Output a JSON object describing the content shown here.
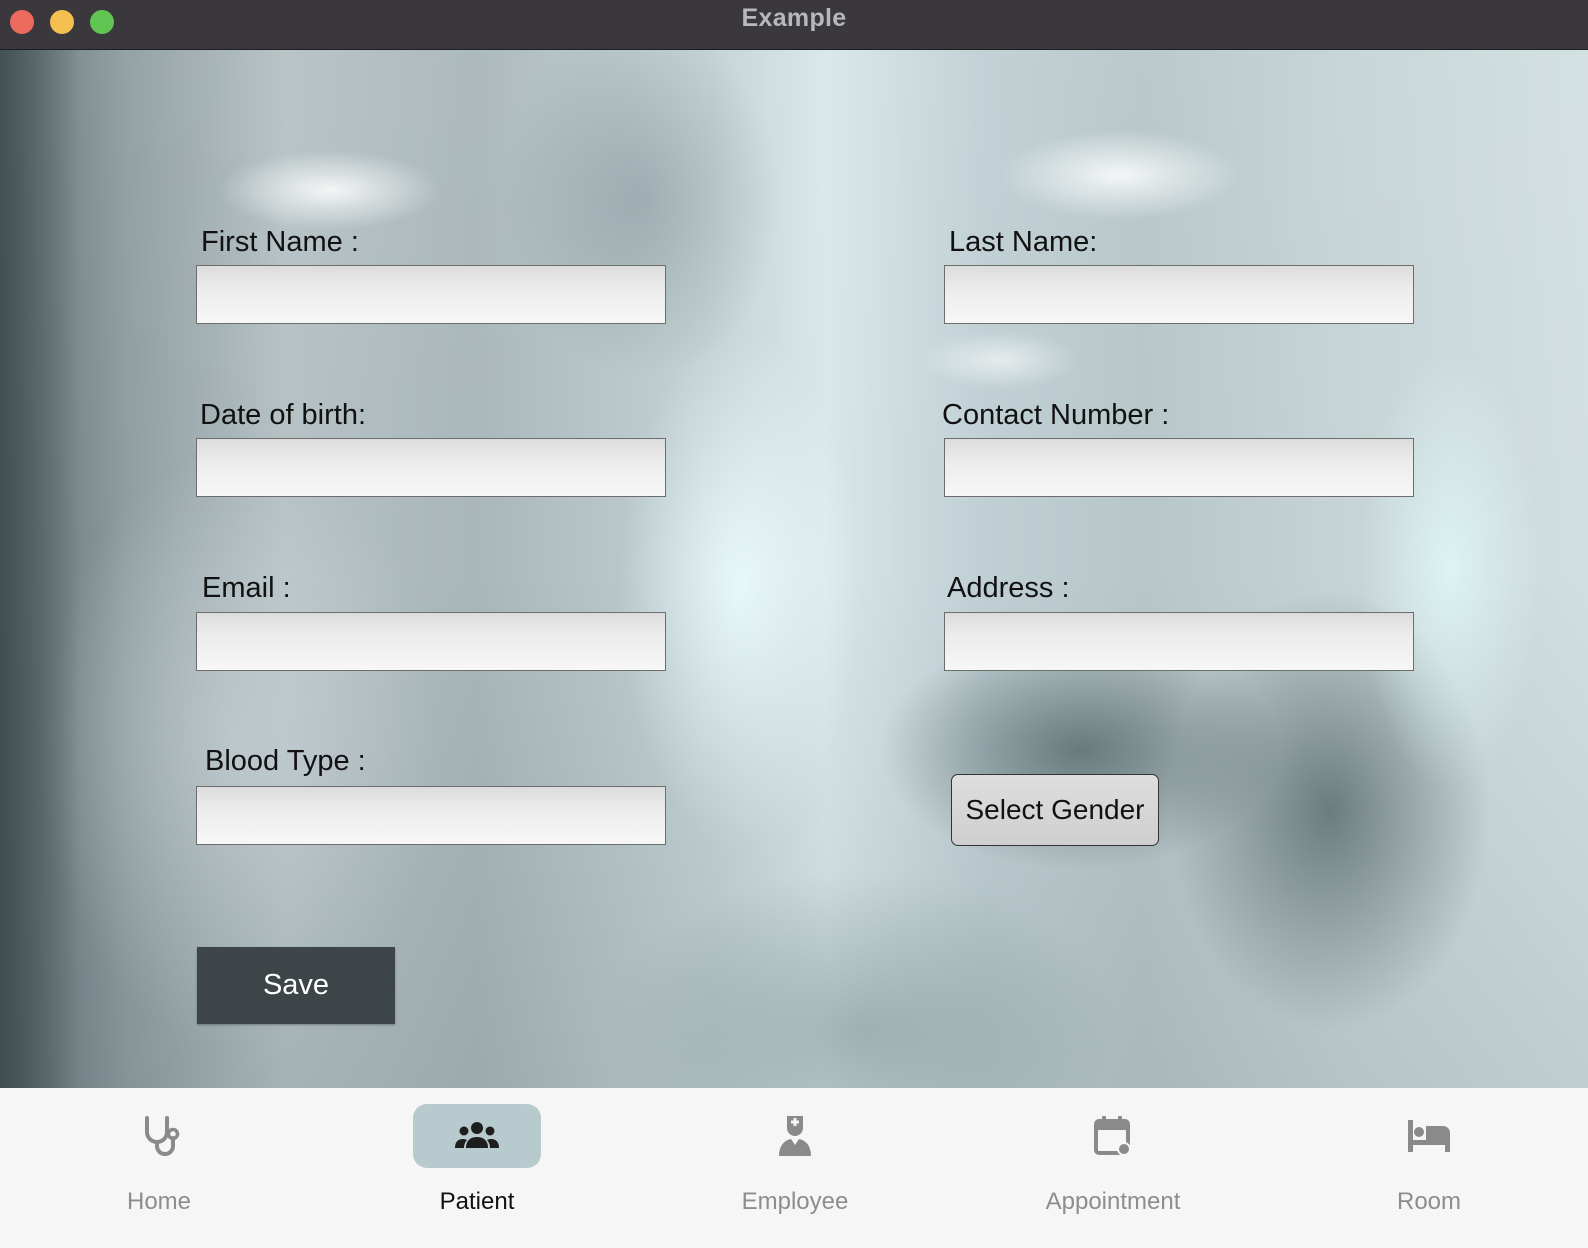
{
  "window": {
    "title": "Example"
  },
  "form": {
    "first_name": {
      "label": "First Name :",
      "value": ""
    },
    "last_name": {
      "label": "Last Name:",
      "value": ""
    },
    "date_of_birth": {
      "label": "Date of birth:",
      "value": ""
    },
    "contact_number": {
      "label": "Contact Number :",
      "value": ""
    },
    "email": {
      "label": "Email :",
      "value": ""
    },
    "address": {
      "label": "Address :",
      "value": ""
    },
    "blood_type": {
      "label": "Blood Type :",
      "value": ""
    },
    "gender_button": "Select Gender",
    "save_button": "Save"
  },
  "bottom_nav": {
    "items": [
      {
        "label": "Home",
        "icon": "stethoscope-icon",
        "active": false
      },
      {
        "label": "Patient",
        "icon": "people-group-icon",
        "active": true
      },
      {
        "label": "Employee",
        "icon": "nurse-icon",
        "active": false
      },
      {
        "label": "Appointment",
        "icon": "calendar-event-icon",
        "active": false
      },
      {
        "label": "Room",
        "icon": "bed-icon",
        "active": false
      }
    ]
  },
  "colors": {
    "title_bar": "#3a383c",
    "save_button_bg": "#3e4548",
    "nav_active_pill": "#b7cbcf",
    "nav_inactive_text": "#8d8d8d",
    "traffic_close": "#ed6a5e",
    "traffic_minimize": "#f5bf4f",
    "traffic_maximize": "#61c554"
  }
}
